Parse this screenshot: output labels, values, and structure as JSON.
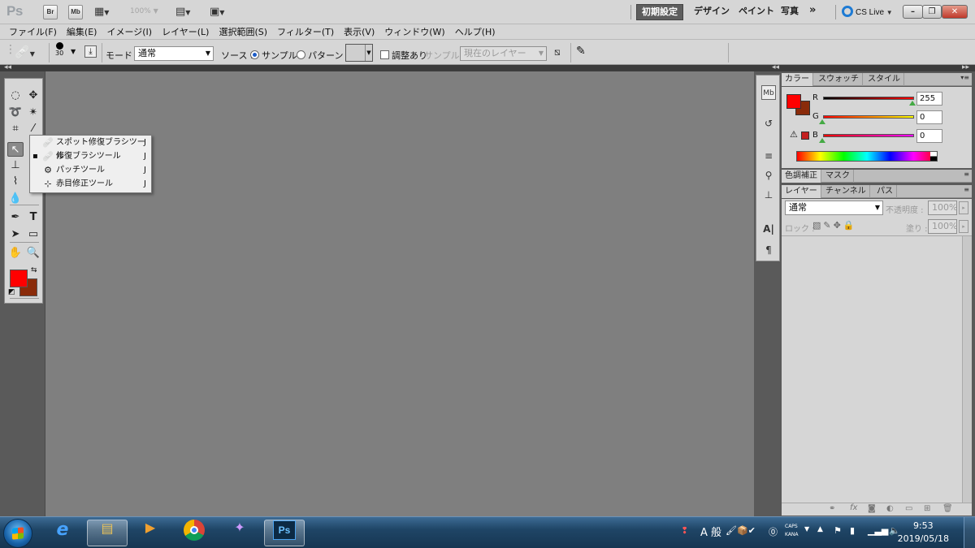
{
  "appbar": {
    "logo": "Ps",
    "bridge": "Br",
    "minibridge": "Mb",
    "zoom": "100%",
    "workspaces": [
      "初期設定",
      "デザイン",
      "ペイント",
      "写真"
    ],
    "more": "»",
    "cslive": "CS Live"
  },
  "menu": [
    "ファイル(F)",
    "編集(E)",
    "イメージ(I)",
    "レイヤー(L)",
    "選択範囲(S)",
    "フィルター(T)",
    "表示(V)",
    "ウィンドウ(W)",
    "ヘルプ(H)"
  ],
  "options": {
    "brush_size": "30",
    "mode_label": "モード :",
    "mode_value": "通常",
    "source_label": "ソース :",
    "sample_label": "サンプル",
    "pattern_label": "パターン :",
    "aligned_label": "調整あり",
    "sample_layer_label": "サンプル :",
    "sample_layer_value": "現在のレイヤー"
  },
  "tools_flyout": [
    {
      "label": "スポット修復ブラシツール",
      "key": "J",
      "icon": "spot-healing-brush-icon",
      "selected": false
    },
    {
      "label": "修復ブラシツール",
      "key": "J",
      "icon": "healing-brush-icon",
      "selected": true
    },
    {
      "label": "パッチツール",
      "key": "J",
      "icon": "patch-icon",
      "selected": false
    },
    {
      "label": "赤目修正ツール",
      "key": "J",
      "icon": "red-eye-icon",
      "selected": false
    }
  ],
  "colors": {
    "foreground": "#ff0000",
    "background": "#8a2b0a",
    "canvas": "#7f7f7f",
    "chrome": "#d6d6d6"
  },
  "color_panel": {
    "tabs": [
      "カラー",
      "スウォッチ",
      "スタイル"
    ],
    "channels": [
      {
        "name": "R",
        "value": "255"
      },
      {
        "name": "G",
        "value": "0"
      },
      {
        "name": "B",
        "value": "0"
      }
    ]
  },
  "adjust_panel": {
    "tabs": [
      "色調補正",
      "マスク"
    ]
  },
  "layers_panel": {
    "tabs": [
      "レイヤー",
      "チャンネル",
      "パス"
    ],
    "blend_mode": "通常",
    "opacity_label": "不透明度 :",
    "opacity_value": "100%",
    "lock_label": "ロック :",
    "fill_label": "塗り :",
    "fill_value": "100%"
  },
  "taskbar": {
    "ime_mode": "A 般",
    "caps": "CAPS",
    "kana": "KANA",
    "time": "9:53",
    "date": "2019/05/18"
  }
}
